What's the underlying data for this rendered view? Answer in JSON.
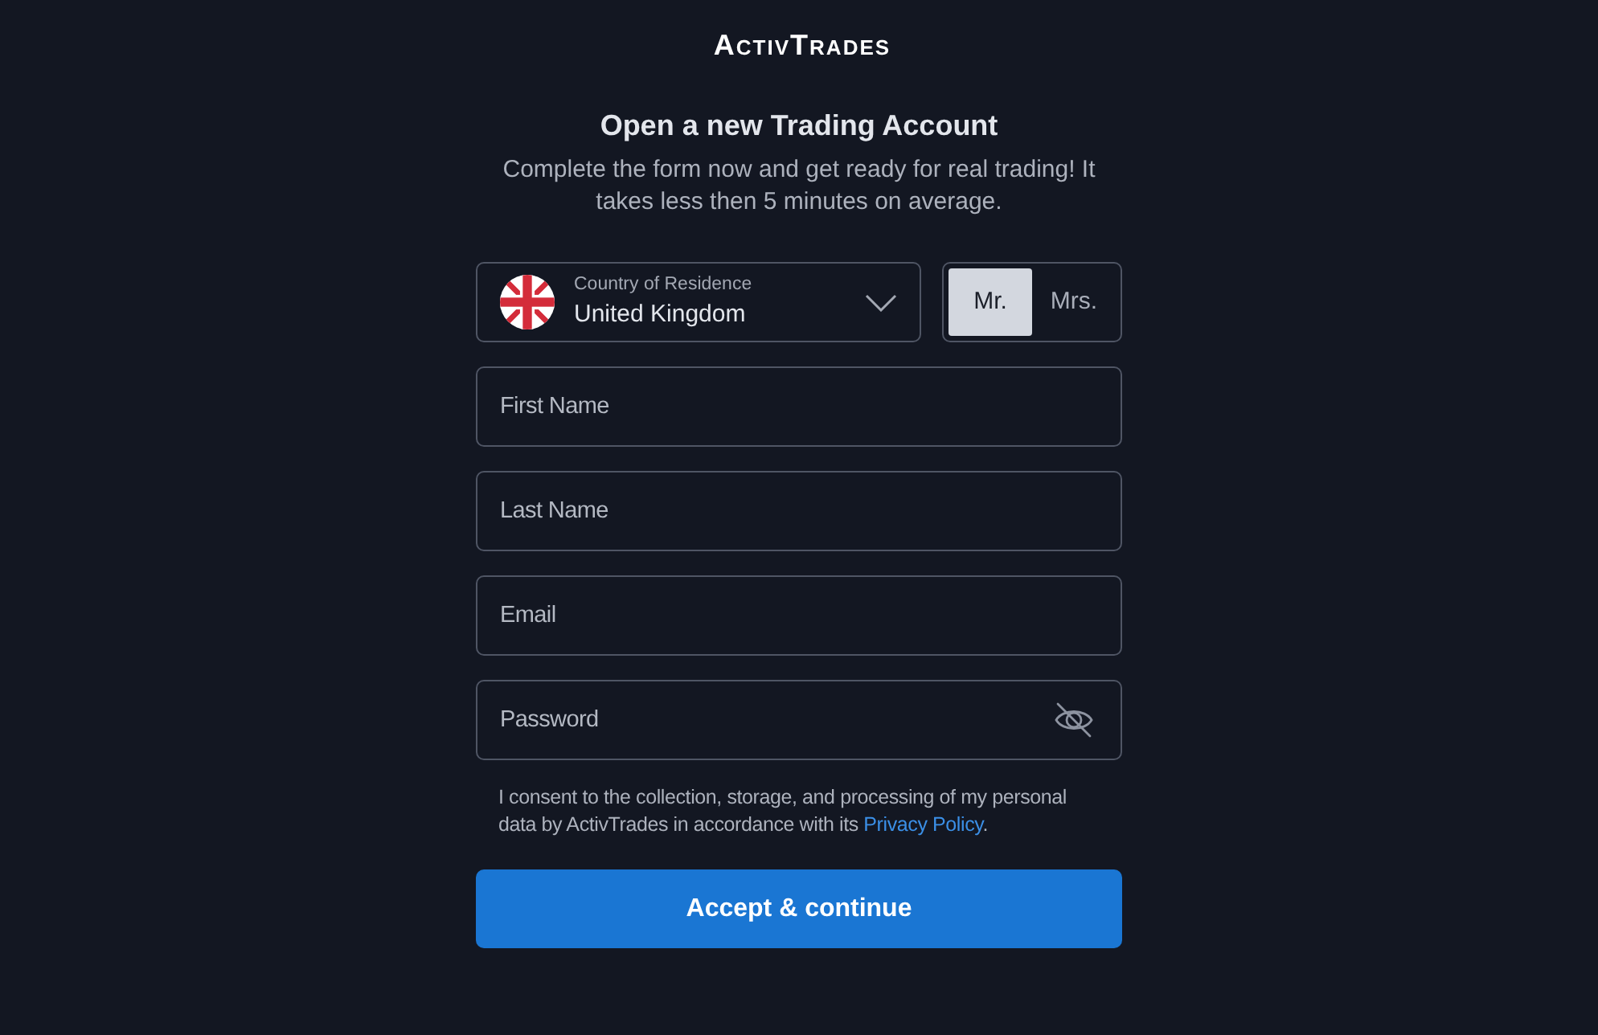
{
  "logo": {
    "part_1": "ACTIV",
    "part_2": "TRADES"
  },
  "heading": {
    "title": "Open a new Trading Account",
    "subtitle": "Complete the form now and get ready for real trading! It takes less then 5 minutes on average."
  },
  "country": {
    "label": "Country of Residence",
    "value": "United Kingdom"
  },
  "salutations": [
    {
      "label": "Mr.",
      "selected": true
    },
    {
      "label": "Mrs.",
      "selected": false
    }
  ],
  "fields": [
    {
      "kind": "text",
      "placeholder": "First Name"
    },
    {
      "kind": "text",
      "placeholder": "Last Name"
    },
    {
      "kind": "text",
      "placeholder": "Email"
    },
    {
      "kind": "password",
      "placeholder": "Password"
    }
  ],
  "consent": {
    "text": "I consent to the collection, storage, and processing of my personal data by ActivTrades in accordance with its",
    "link": "Privacy Policy",
    "end": "."
  },
  "submit": {
    "label": "Accept & continue"
  }
}
